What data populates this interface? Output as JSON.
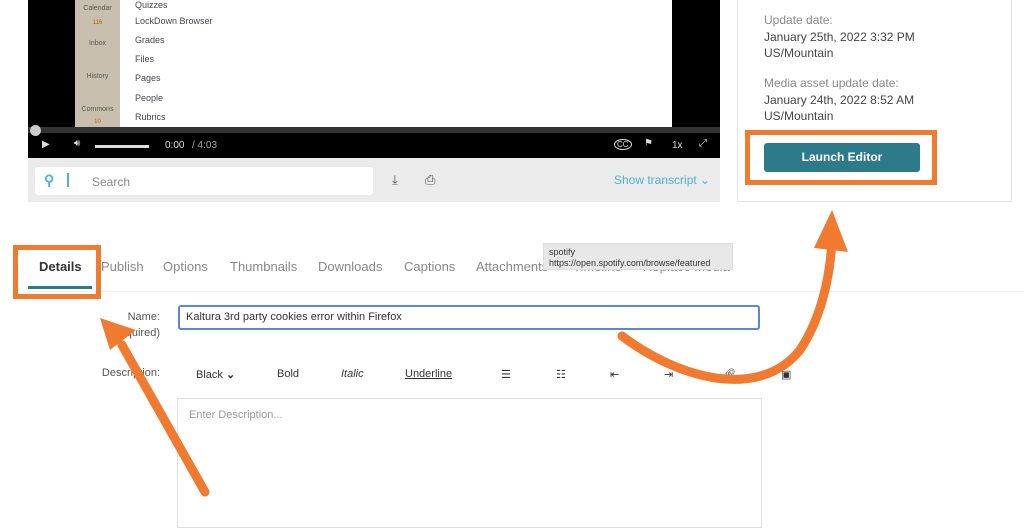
{
  "video": {
    "sidebar": [
      "Calendar",
      "Inbox",
      "History",
      "Commons"
    ],
    "inbox_badge": "116",
    "commons_badge": "10",
    "course_nav": [
      "Quizzes",
      "LockDown Browser",
      "Grades",
      "Files",
      "Pages",
      "People",
      "Rubrics"
    ],
    "time_current": "0:00",
    "time_total": "/ 4:03",
    "speed": "1x",
    "progress_percent": 0
  },
  "search": {
    "placeholder": "Search",
    "show_transcript": "Show transcript"
  },
  "info": {
    "update_label": "Update date:",
    "update_value": "January 25th, 2022 3:32 PM",
    "update_tz": "US/Mountain",
    "asset_label": "Media asset update date:",
    "asset_value": "January 24th, 2022 8:52 AM",
    "asset_tz": "US/Mountain",
    "launch_editor": "Launch Editor"
  },
  "tabs": [
    "Details",
    "Publish",
    "Options",
    "Thumbnails",
    "Downloads",
    "Captions",
    "Attachments",
    "Timeline",
    "Replace Media"
  ],
  "tooltip": {
    "title": "spotify",
    "url": "https://open.spotify.com/browse/featured"
  },
  "form": {
    "name_label": "Name:",
    "required": "(required)",
    "name_value": "Kaltura 3rd party cookies error within Firefox",
    "description_label": "Description:",
    "desc_placeholder": "Enter Description...",
    "toolbar": {
      "color": "Black",
      "bold": "Bold",
      "italic": "Italic",
      "underline": "Underline"
    }
  },
  "colors": {
    "accent": "#2c7a8a",
    "annotation": "#f07a2f",
    "link": "#4ab3d4"
  }
}
